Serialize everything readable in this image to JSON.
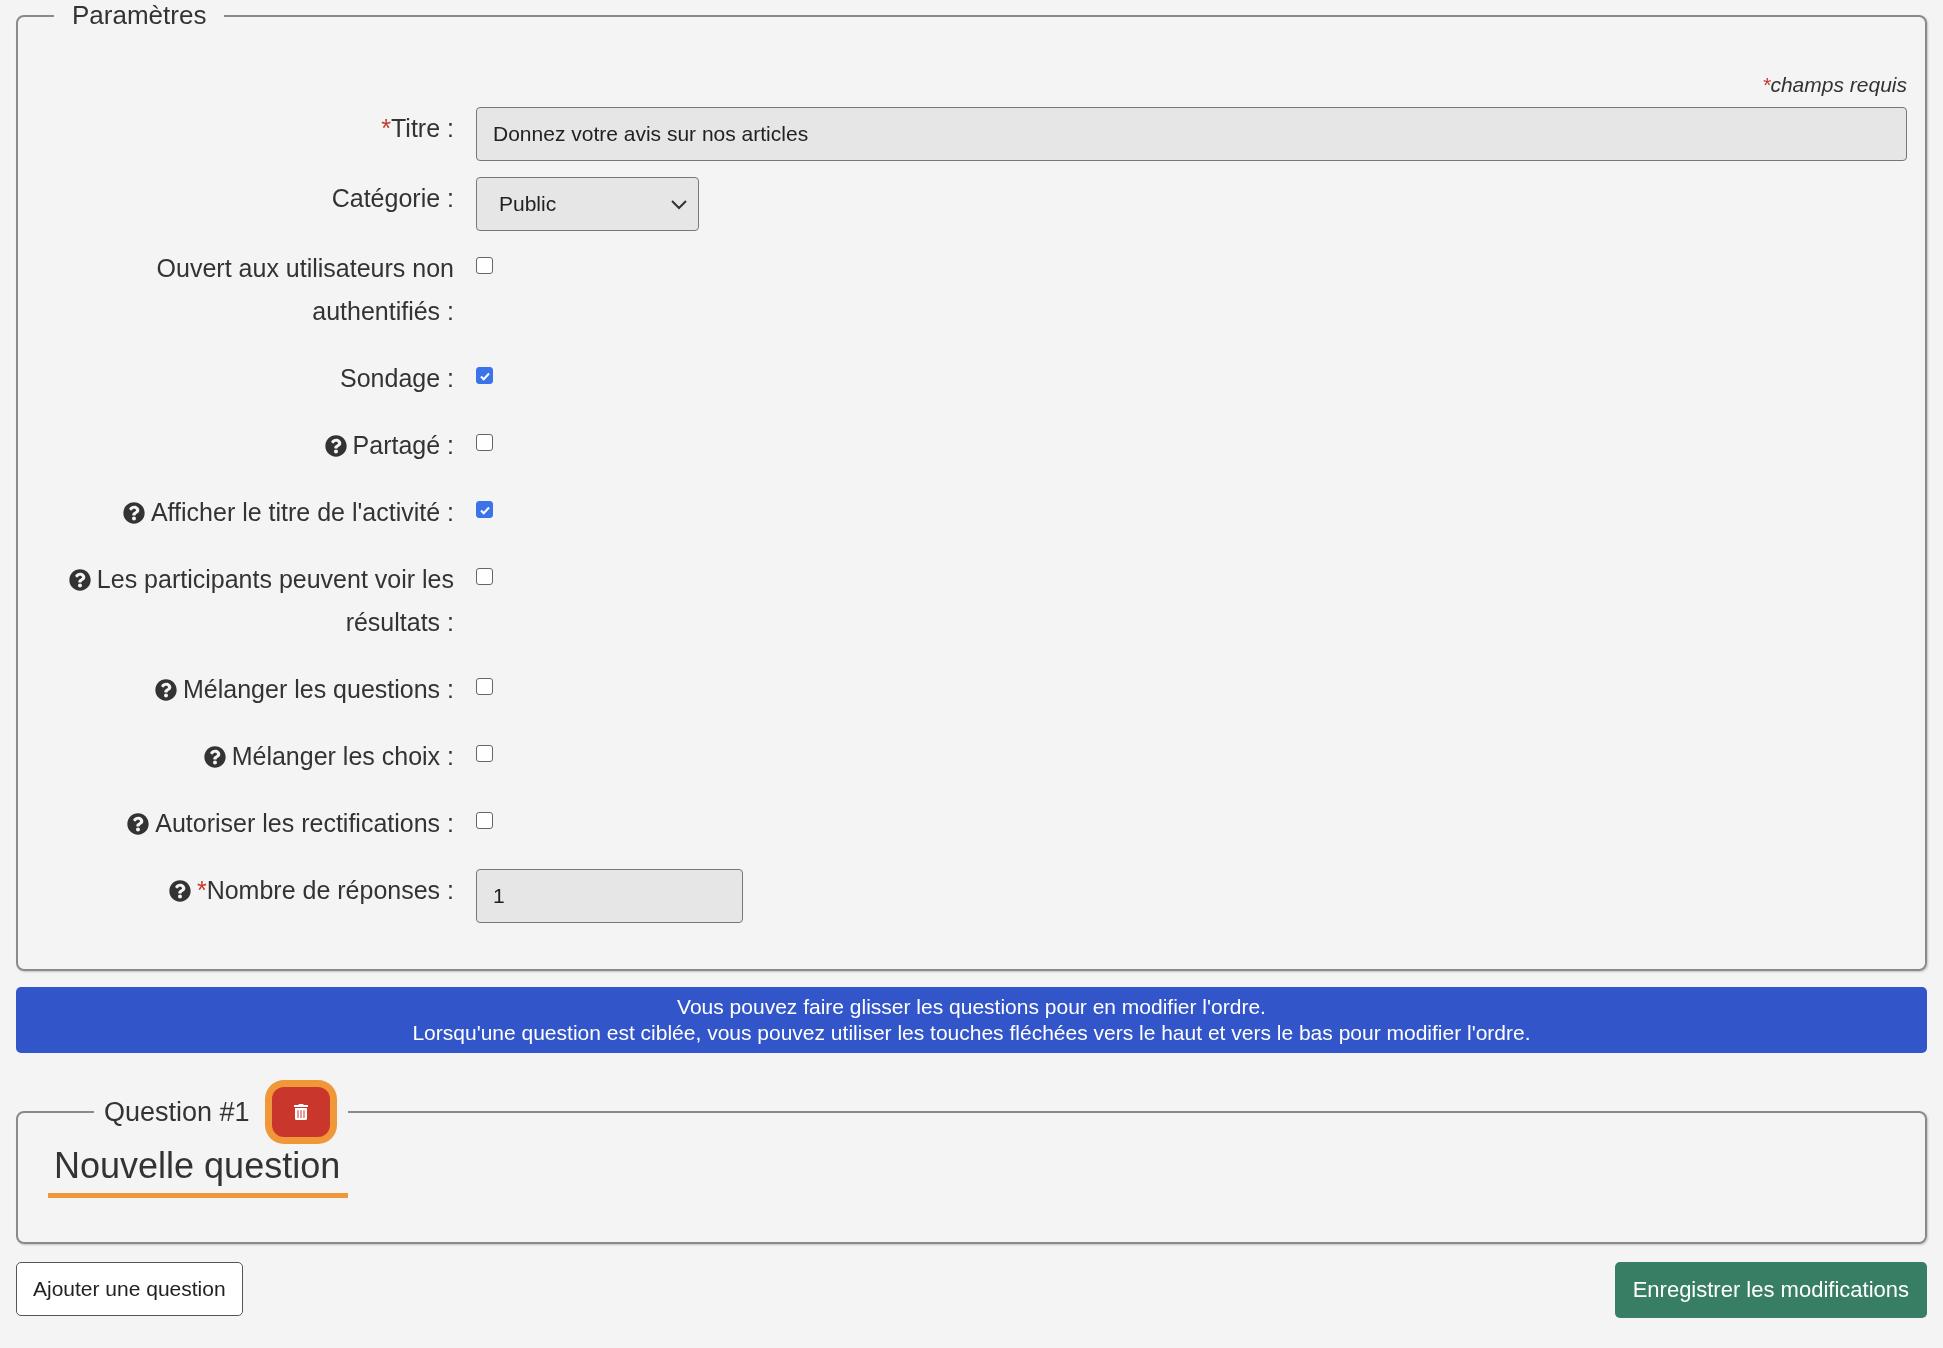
{
  "settings": {
    "legend": "Paramètres",
    "required_note": {
      "mark": "*",
      "text": "champs requis"
    },
    "fields": [
      {
        "kind": "text",
        "label": "Titre :",
        "required": true,
        "help": false,
        "value": "Donnez votre avis sur nos articles"
      },
      {
        "kind": "select",
        "label": "Catégorie :",
        "required": false,
        "help": false,
        "value": "Public"
      },
      {
        "kind": "checkbox",
        "label": "Ouvert aux utilisateurs non authentifiés :",
        "required": false,
        "help": false,
        "checked": false
      },
      {
        "kind": "checkbox",
        "label": "Sondage :",
        "required": false,
        "help": false,
        "checked": true
      },
      {
        "kind": "checkbox",
        "label": "Partagé :",
        "required": false,
        "help": true,
        "checked": false
      },
      {
        "kind": "checkbox",
        "label": "Afficher le titre de l'activité :",
        "required": false,
        "help": true,
        "checked": true
      },
      {
        "kind": "checkbox",
        "label": "Les participants peuvent voir les résultats :",
        "required": false,
        "help": true,
        "checked": false
      },
      {
        "kind": "checkbox",
        "label": "Mélanger les questions :",
        "required": false,
        "help": true,
        "checked": false
      },
      {
        "kind": "checkbox",
        "label": "Mélanger les choix :",
        "required": false,
        "help": true,
        "checked": false
      },
      {
        "kind": "checkbox",
        "label": "Autoriser les rectifications :",
        "required": false,
        "help": true,
        "checked": false
      },
      {
        "kind": "number",
        "label": "Nombre de réponses :",
        "required": true,
        "help": true,
        "value": "1"
      }
    ]
  },
  "info_banner": [
    "Vous pouvez faire glisser les questions pour en modifier l'ordre.",
    "Lorsqu'une question est ciblée, vous pouvez utiliser les touches fléchées vers le haut et vers le bas pour modifier l'ordre."
  ],
  "questions": [
    {
      "legend": "Question #1",
      "delete_highlighted": true,
      "title": "Nouvelle question",
      "title_underlined": true
    }
  ],
  "buttons": {
    "add": "Ajouter une question",
    "save": "Enregistrer les modifications"
  }
}
